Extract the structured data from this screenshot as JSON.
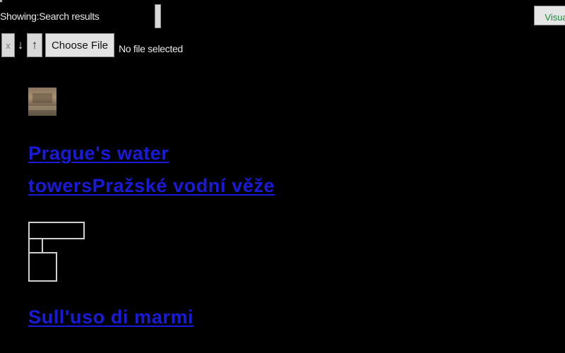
{
  "header": {
    "showing_label": "Showing:",
    "search_value": "Search results",
    "visual_button_label": "Visual"
  },
  "toolbar": {
    "clear_label": "x",
    "move_down_label": "↓",
    "move_up_label": "↑",
    "choose_file_label": "Choose File",
    "file_status": "No file selected"
  },
  "results": [
    {
      "title": "Prague's water towersPražské vodní věže",
      "thumbnail": "water-tower-photo"
    },
    {
      "title": "Sull'uso di marmi",
      "thumbnail": "broken-image-icon"
    }
  ],
  "colors": {
    "background": "#000000",
    "link": "#1a1adb",
    "visual_button_text": "#1b8a3a"
  }
}
